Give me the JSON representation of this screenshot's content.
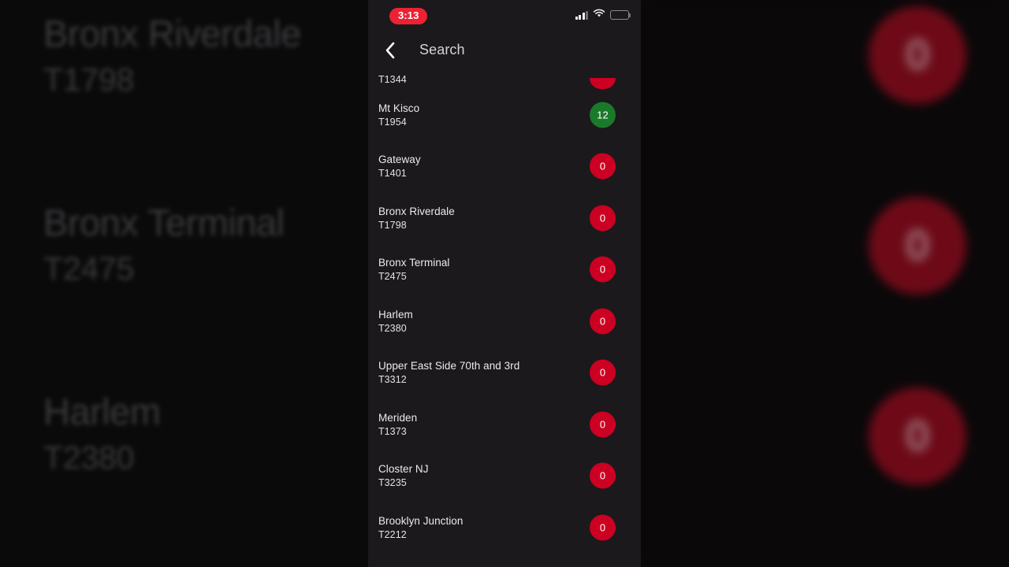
{
  "app": {
    "background_color": "#0a0909",
    "panel_color": "#1b191c"
  },
  "status_bar": {
    "time": "3:13",
    "time_pill_color": "#eb2233",
    "icons": [
      "cellular-signal-icon",
      "wifi-icon",
      "battery-low-icon"
    ],
    "battery_level_percent": 26
  },
  "nav": {
    "back_label": "‹",
    "title": "Search"
  },
  "list": {
    "partial_top_row": {
      "code": "T1344",
      "badge": "",
      "badge_color": "#cc0022"
    },
    "rows": [
      {
        "name": "Mt Kisco",
        "code": "T1954",
        "badge": "12",
        "badge_color": "#1a7a2a"
      },
      {
        "name": "Gateway",
        "code": "T1401",
        "badge": "0",
        "badge_color": "#cc0022"
      },
      {
        "name": "Bronx Riverdale",
        "code": "T1798",
        "badge": "0",
        "badge_color": "#cc0022"
      },
      {
        "name": "Bronx Terminal",
        "code": "T2475",
        "badge": "0",
        "badge_color": "#cc0022"
      },
      {
        "name": "Harlem",
        "code": "T2380",
        "badge": "0",
        "badge_color": "#cc0022"
      },
      {
        "name": "Upper East Side 70th and 3rd",
        "code": "T3312",
        "badge": "0",
        "badge_color": "#cc0022"
      },
      {
        "name": "Meriden",
        "code": "T1373",
        "badge": "0",
        "badge_color": "#cc0022"
      },
      {
        "name": "Closter NJ",
        "code": "T3235",
        "badge": "0",
        "badge_color": "#cc0022"
      },
      {
        "name": "Brooklyn Junction",
        "code": "T2212",
        "badge": "0",
        "badge_color": "#cc0022"
      }
    ]
  },
  "background_left": {
    "rows": [
      {
        "name": "Bronx Riverdale",
        "code": "T1798"
      },
      {
        "name": "Bronx Terminal",
        "code": "T2475"
      },
      {
        "name": "Harlem",
        "code": "T2380"
      }
    ]
  },
  "background_right": {
    "badges": [
      "0",
      "0",
      "0"
    ]
  }
}
